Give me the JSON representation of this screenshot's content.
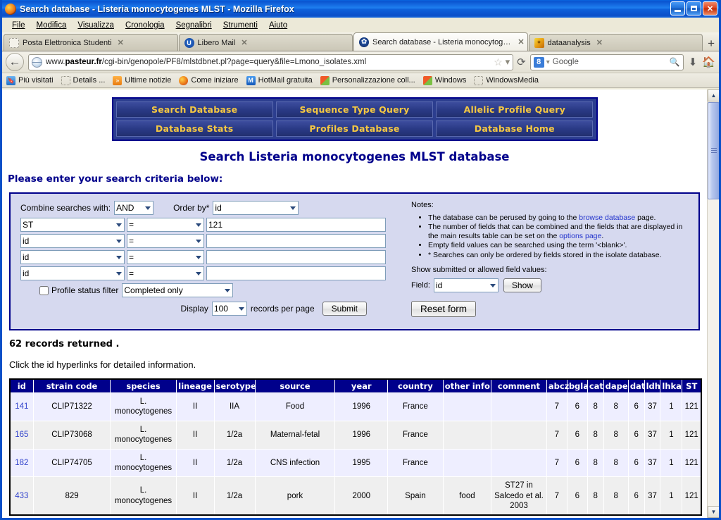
{
  "window": {
    "title": "Search database - Listeria monocytogenes MLST - Mozilla Firefox",
    "minimize_label": "_",
    "maximize_label": "❐",
    "close_label": "✕"
  },
  "menubar": [
    {
      "label": "File"
    },
    {
      "label": "Modifica"
    },
    {
      "label": "Visualizza"
    },
    {
      "label": "Cronologia"
    },
    {
      "label": "Segnalibri"
    },
    {
      "label": "Strumenti"
    },
    {
      "label": "Aiuto"
    }
  ],
  "tabs": [
    {
      "label": "Posta Elettronica Studenti",
      "close": "✕",
      "icon": "blank-page-icon",
      "active": false
    },
    {
      "label": "Libero Mail",
      "close": "✕",
      "icon": "libero-icon",
      "active": false
    },
    {
      "label": "Search database - Listeria monocytogen...",
      "close": "✕",
      "icon": "pasteur-icon",
      "active": true
    },
    {
      "label": "dataanalysis",
      "close": "✕",
      "icon": "dataanalysis-icon",
      "active": false
    }
  ],
  "new_tab_label": "+",
  "navbar": {
    "back_label": "◀",
    "url_prefix": "www.",
    "url_domain": "pasteur.fr",
    "url_path": "/cgi-bin/genopole/PF8/mlstdbnet.pl?page=query&file=Lmono_isolates.xml",
    "star_icon": "☆",
    "dropdown_icon": "▾",
    "reload_icon": "⟳",
    "search_engine": "Google",
    "search_glass": "🔍",
    "download_icon": "⬇",
    "home_icon": "🏠"
  },
  "bookmarks": [
    {
      "label": "Più visitati",
      "icon": "most-visited-icon"
    },
    {
      "label": "Details ...",
      "icon": "blank-page-icon"
    },
    {
      "label": "Ultime notizie",
      "icon": "rss-icon"
    },
    {
      "label": "Come iniziare",
      "icon": "firefox-icon"
    },
    {
      "label": "HotMail gratuita",
      "icon": "hotmail-icon"
    },
    {
      "label": "Personalizzazione coll...",
      "icon": "windows-icon"
    },
    {
      "label": "Windows",
      "icon": "windows-icon"
    },
    {
      "label": "WindowsMedia",
      "icon": "blank-page-icon"
    }
  ],
  "nav_buttons": {
    "row1": [
      "Search Database",
      "Sequence Type Query",
      "Allelic Profile Query"
    ],
    "row2": [
      "Database Stats",
      "Profiles Database",
      "Database Home"
    ]
  },
  "page": {
    "title": "Search Listeria monocytogenes MLST database",
    "criteria_heading": "Please enter your search criteria below:",
    "records_returned": "62 records returned .",
    "click_hint": "Click the id hyperlinks for detailed information."
  },
  "form": {
    "combine_label": "Combine searches with:",
    "combine_value": "AND",
    "orderby_label": "Order by*",
    "orderby_value": "id",
    "rows": [
      {
        "field": "ST",
        "operator": "=",
        "value": "121"
      },
      {
        "field": "id",
        "operator": "=",
        "value": ""
      },
      {
        "field": "id",
        "operator": "=",
        "value": ""
      },
      {
        "field": "id",
        "operator": "=",
        "value": ""
      }
    ],
    "profile_filter_label": "Profile status filter",
    "profile_filter_value": "Completed only",
    "profile_filter_checked": false,
    "display_label": "Display",
    "display_value": "100",
    "records_per_page_label": "records per page",
    "submit_label": "Submit"
  },
  "notes": {
    "heading": "Notes:",
    "items": [
      {
        "pre": "The database can be perused by going to the ",
        "link": "browse database",
        "post": " page."
      },
      {
        "pre": "The number of fields that can be combined and the fields that are displayed in the main results table can be set on the ",
        "link": "options page",
        "post": "."
      },
      {
        "pre": "Empty field values can be searched using the term '<blank>'.",
        "link": "",
        "post": ""
      },
      {
        "pre": "* Searches can only be ordered by fields stored in the isolate database.",
        "link": "",
        "post": ""
      }
    ],
    "show_heading": "Show submitted or allowed field values:",
    "field_label": "Field:",
    "field_value": "id",
    "show_button": "Show",
    "reset_button": "Reset form"
  },
  "results_table": {
    "columns": [
      "id",
      "strain code",
      "species",
      "lineage",
      "serotype",
      "source",
      "year",
      "country",
      "other info",
      "comment",
      "abcz",
      "bgla",
      "cat",
      "dape",
      "dat",
      "ldh",
      "lhka",
      "ST"
    ],
    "rows": [
      {
        "id": "141",
        "strain_code": "CLIP71322",
        "species": "L. monocytogenes",
        "lineage": "II",
        "serotype": "IIA",
        "source": "Food",
        "year": "1996",
        "country": "France",
        "other_info": "",
        "comment": "",
        "abcz": "7",
        "bgla": "6",
        "cat": "8",
        "dape": "8",
        "dat": "6",
        "ldh": "37",
        "lhka": "1",
        "ST": "121"
      },
      {
        "id": "165",
        "strain_code": "CLIP73068",
        "species": "L. monocytogenes",
        "lineage": "II",
        "serotype": "1/2a",
        "source": "Maternal-fetal",
        "year": "1996",
        "country": "France",
        "other_info": "",
        "comment": "",
        "abcz": "7",
        "bgla": "6",
        "cat": "8",
        "dape": "8",
        "dat": "6",
        "ldh": "37",
        "lhka": "1",
        "ST": "121"
      },
      {
        "id": "182",
        "strain_code": "CLIP74705",
        "species": "L. monocytogenes",
        "lineage": "II",
        "serotype": "1/2a",
        "source": "CNS infection",
        "year": "1995",
        "country": "France",
        "other_info": "",
        "comment": "",
        "abcz": "7",
        "bgla": "6",
        "cat": "8",
        "dape": "8",
        "dat": "6",
        "ldh": "37",
        "lhka": "1",
        "ST": "121"
      },
      {
        "id": "433",
        "strain_code": "829",
        "species": "L. monocytogenes",
        "lineage": "II",
        "serotype": "1/2a",
        "source": "pork",
        "year": "2000",
        "country": "Spain",
        "other_info": "food",
        "comment": "ST27 in Salcedo et al. 2003",
        "abcz": "7",
        "bgla": "6",
        "cat": "8",
        "dape": "8",
        "dat": "6",
        "ldh": "37",
        "lhka": "1",
        "ST": "121"
      }
    ]
  },
  "scrollbar": {
    "up_arrow": "▲",
    "down_arrow": "▼"
  },
  "colors": {
    "nav_button_bg": "#2a3a86",
    "nav_button_text": "#f5c842",
    "heading_blue": "#00008b",
    "panel_bg": "#d6d9ef",
    "table_header_bg": "#00008b",
    "row_odd": "#eeeeff",
    "row_even": "#efefef",
    "link_blue": "#3344cc"
  }
}
